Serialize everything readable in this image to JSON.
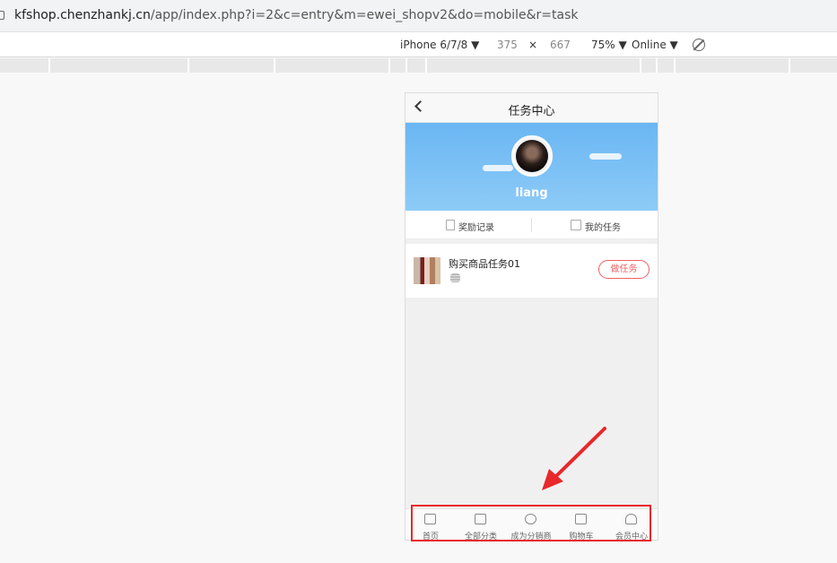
{
  "browser": {
    "url_host": "kfshop.chenzhankj.cn",
    "url_path": "/app/index.php?i=2&c=entry&m=ewei_shopv2&do=mobile&r=task"
  },
  "devtools": {
    "device": "iPhone 6/7/8 ▼",
    "width": "375",
    "times": "×",
    "height": "667",
    "zoom": "75% ▼",
    "network": "Online ▼"
  },
  "phone": {
    "title": "任务中心",
    "username": "liang",
    "tabs": [
      {
        "label": "奖励记录",
        "icon": "document-icon"
      },
      {
        "label": "我的任务",
        "icon": "gift-icon"
      }
    ],
    "tasks": [
      {
        "name": "购买商品任务01",
        "button": "做任务",
        "icon": "coin-stack-icon"
      }
    ],
    "tabbar": [
      {
        "label": "首页",
        "icon": "home-icon"
      },
      {
        "label": "全部分类",
        "icon": "category-icon"
      },
      {
        "label": "成为分销商",
        "icon": "users-icon"
      },
      {
        "label": "购物车",
        "icon": "cart-icon"
      },
      {
        "label": "会员中心",
        "icon": "user-icon"
      }
    ]
  },
  "annotation": {
    "color": "#e8282b"
  }
}
